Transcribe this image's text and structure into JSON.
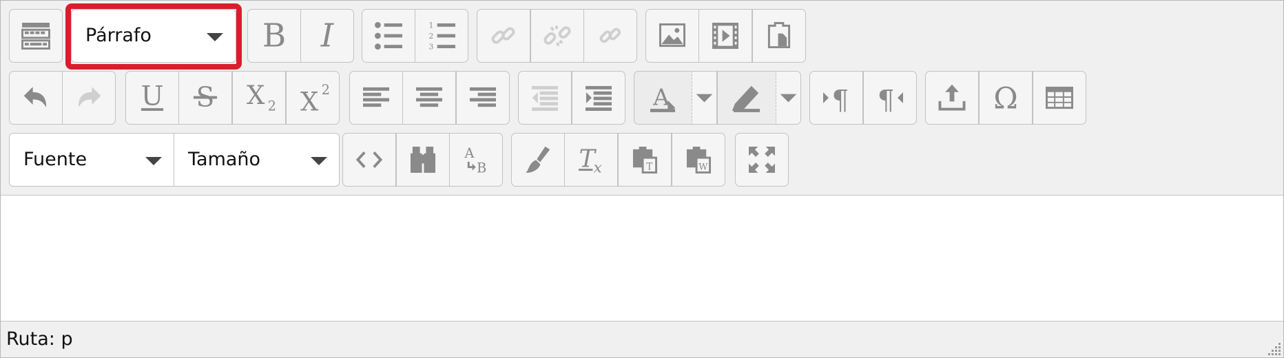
{
  "toolbar": {
    "paragraph_format": "Párrafo",
    "font_family": "Fuente",
    "font_size": "Tamaño",
    "bold_glyph": "B",
    "italic_glyph": "I",
    "underline_glyph": "U",
    "strike_glyph": "S",
    "subscript_glyph": "X",
    "superscript_glyph": "X",
    "omega_glyph": "Ω",
    "clear_format_glyph": "T"
  },
  "status": {
    "path": "Ruta: p"
  },
  "colors": {
    "highlight": "#d81e2c",
    "icon": "#8a8a8a",
    "disabled_icon": "#cfcfcf"
  }
}
